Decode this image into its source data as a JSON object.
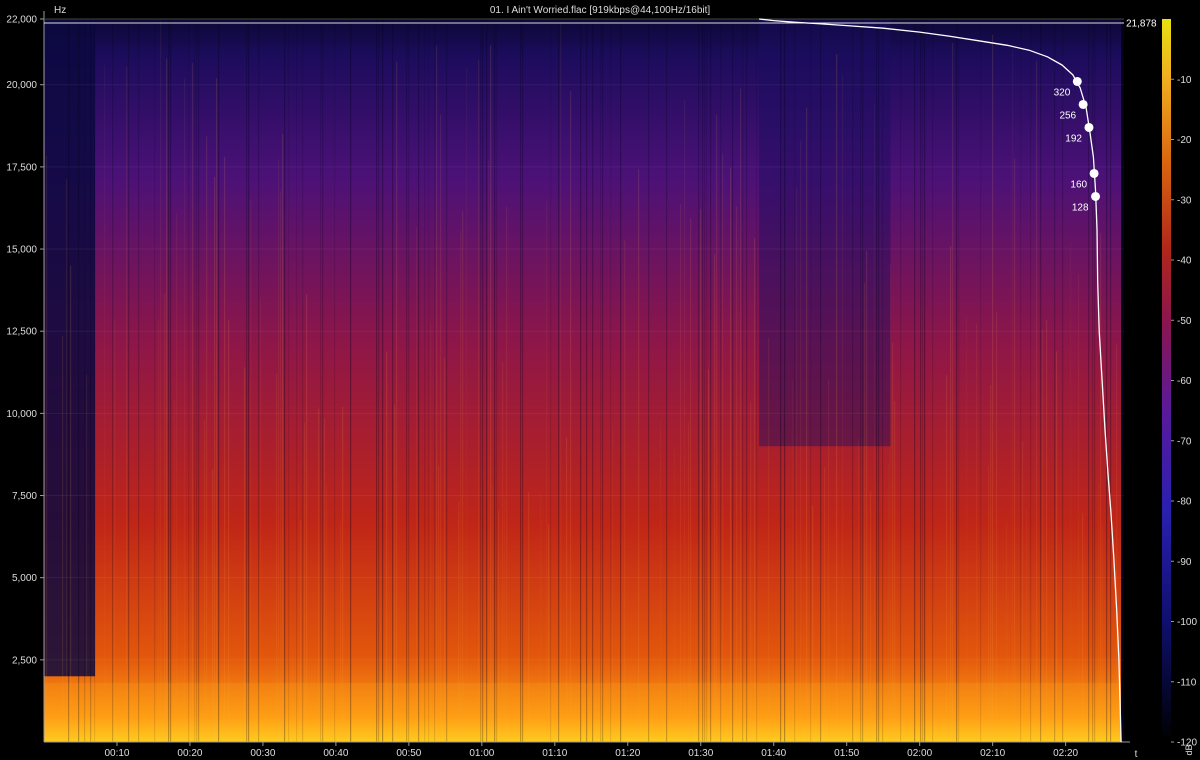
{
  "chart_data": {
    "type": "heatmap",
    "title": "01. I Ain't Worried.flac [919kbps@44,100Hz/16bit]",
    "xlabel": "t",
    "ylabel": "Hz",
    "xlim": [
      0,
      148
    ],
    "ylim": [
      0,
      22000
    ],
    "x_ticks": [
      {
        "value": 10,
        "label": "00:10"
      },
      {
        "value": 20,
        "label": "00:20"
      },
      {
        "value": 30,
        "label": "00:30"
      },
      {
        "value": 40,
        "label": "00:40"
      },
      {
        "value": 50,
        "label": "00:50"
      },
      {
        "value": 60,
        "label": "01:00"
      },
      {
        "value": 70,
        "label": "01:10"
      },
      {
        "value": 80,
        "label": "01:20"
      },
      {
        "value": 90,
        "label": "01:30"
      },
      {
        "value": 100,
        "label": "01:40"
      },
      {
        "value": 110,
        "label": "01:50"
      },
      {
        "value": 120,
        "label": "02:00"
      },
      {
        "value": 130,
        "label": "02:10"
      },
      {
        "value": 140,
        "label": "02:20"
      }
    ],
    "y_ticks": [
      {
        "value": 2500,
        "label": "2,500"
      },
      {
        "value": 5000,
        "label": "5,000"
      },
      {
        "value": 7500,
        "label": "7,500"
      },
      {
        "value": 10000,
        "label": "10,000"
      },
      {
        "value": 12500,
        "label": "12,500"
      },
      {
        "value": 15000,
        "label": "15,000"
      },
      {
        "value": 17500,
        "label": "17,500"
      },
      {
        "value": 20000,
        "label": "20,000"
      },
      {
        "value": 22000,
        "label": "22,000"
      }
    ],
    "cutoff_line": {
      "value": 21878,
      "label": "21,878"
    },
    "bitrate_markers": [
      {
        "label": "320",
        "t": 141.6,
        "hz": 20100
      },
      {
        "label": "256",
        "t": 142.4,
        "hz": 19400
      },
      {
        "label": "192",
        "t": 143.2,
        "hz": 18700
      },
      {
        "label": "160",
        "t": 143.9,
        "hz": 17300
      },
      {
        "label": "128",
        "t": 144.1,
        "hz": 16600
      }
    ],
    "colorbar": {
      "unit": "dB",
      "range": [
        -120,
        0
      ],
      "ticks": [
        {
          "value": -10,
          "label": "-10"
        },
        {
          "value": -20,
          "label": "-20"
        },
        {
          "value": -30,
          "label": "-30"
        },
        {
          "value": -40,
          "label": "-40"
        },
        {
          "value": -50,
          "label": "-50"
        },
        {
          "value": -60,
          "label": "-60"
        },
        {
          "value": -70,
          "label": "-70"
        },
        {
          "value": -80,
          "label": "-80"
        },
        {
          "value": -90,
          "label": "-90"
        },
        {
          "value": -100,
          "label": "-100"
        },
        {
          "value": -110,
          "label": "-110"
        },
        {
          "value": -120,
          "label": "-120"
        }
      ]
    },
    "spectral_profile": [
      [
        98,
        22000
      ],
      [
        100,
        21950
      ],
      [
        103,
        21900
      ],
      [
        106,
        21860
      ],
      [
        110,
        21800
      ],
      [
        115,
        21720
      ],
      [
        120,
        21600
      ],
      [
        124,
        21480
      ],
      [
        128,
        21340
      ],
      [
        132,
        21200
      ],
      [
        135,
        21050
      ],
      [
        137.5,
        20850
      ],
      [
        139.5,
        20600
      ],
      [
        141,
        20300
      ],
      [
        142,
        19900
      ],
      [
        142.8,
        19300
      ],
      [
        143.3,
        18600
      ],
      [
        143.8,
        17800
      ],
      [
        144.1,
        16800
      ],
      [
        144.3,
        15600
      ],
      [
        144.4,
        14000
      ],
      [
        144.6,
        12500
      ],
      [
        145.0,
        11000
      ],
      [
        145.4,
        9500
      ],
      [
        145.8,
        8200
      ],
      [
        146.2,
        7000
      ],
      [
        146.6,
        5600
      ],
      [
        147.0,
        4000
      ],
      [
        147.3,
        2500
      ],
      [
        147.5,
        800
      ],
      [
        147.6,
        0
      ]
    ]
  }
}
